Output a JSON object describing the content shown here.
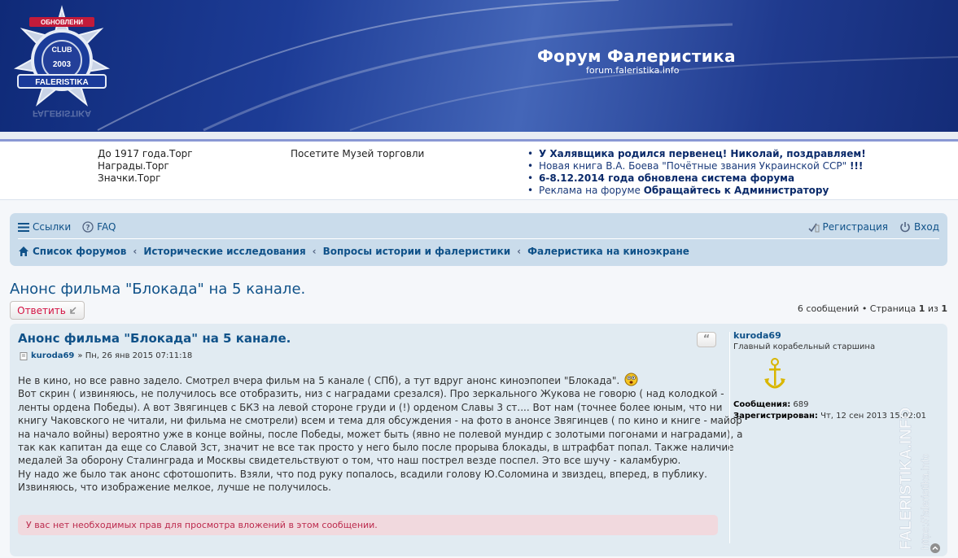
{
  "header": {
    "site_title": "Форум Фалеристика",
    "site_url": "forum.faleristika.info",
    "logo_text": "FALERISTIKA"
  },
  "top_links": {
    "col1": [
      "До 1917 года.Торг",
      "Награды.Торг",
      "Значки.Торг"
    ],
    "col2": [
      "Посетите Музей торговли"
    ],
    "news": [
      {
        "bold": "У Халявщика родился первенец! Николай, поздравляем!",
        "normal": ""
      },
      {
        "bold": "",
        "normal": "Новая книга В.А. Боева \"Почётные звания Украинской ССР\" ",
        "bold_tail": "!!!"
      },
      {
        "bold": "6-8.12.2014 года обновлена система форума",
        "normal": ""
      },
      {
        "bold": "",
        "normal": "Реклама на форуме ",
        "bold_tail": "Обращайтесь к Администратору"
      }
    ]
  },
  "navbar": {
    "links_label": "Ссылки",
    "faq_label": "FAQ",
    "register_label": "Регистрация",
    "login_label": "Вход",
    "breadcrumb": [
      "Список форумов",
      "Исторические исследования",
      "Вопросы истории и фалеристики",
      "Фалеристика на киноэкране"
    ],
    "crumb_separator": "‹"
  },
  "topic": {
    "title": "Анонс фильма \"Блокада\" на 5 канале.",
    "reply_label": "Ответить",
    "pagination": {
      "prefix": "6 сообщений • Страница ",
      "current": "1",
      "middle": " из ",
      "total": "1"
    }
  },
  "post": {
    "title": "Анонс фильма \"Блокада\" на 5 канале.",
    "quote_label": "“",
    "author": "kuroda69",
    "meta_rest": "» Пн, 26 янв 2015 07:11:18",
    "body": [
      "Не в кино, но все равно задело. Смотрел вчера фильм на 5 канале ( СПб), а тут вдруг анонс киноэпопеи \"Блокада\".",
      "Вот скрин ( извиняюсь, не получилось все отобразить, низ с наградами срезался). Про зеркального Жукова не говорю ( над колодкой -",
      "ленты ордена Победы). А вот Звягинцев с БКЗ на левой стороне груди и (!) орденом Славы 3 ст.... Вот нам (точнее более юным, что ни",
      "книгу Чаковского не читали, ни фильма не смотрели) всем и тема для обсуждения - на фото в анонсе Звягинцев ( по кино и книге - майор",
      "на начало войны) вероятно уже в конце войны, после Победы, может быть (явно не полевой мундир с золотыми погонами и наградами), а",
      "так как капитан да еще со Славой 3ст, значит не все так просто у него было после прорыва блокады, в штрафбат попал. Также наличие",
      "медалей За оборону Сталинграда и Москвы свидетельствуют о том, что наш пострел везде поспел. Это все шучу - каламбурю.",
      "Ну надо же было так анонс сфотошопить. Взяли, что под руку попалось, всадили голову Ю.Соломина и звиздец, вперед, в публику.",
      "Извиняюсь, что изображение мелкое, лучше не получилось."
    ],
    "notice": "У вас нет необходимых прав для просмотра вложений в этом сообщении."
  },
  "profile": {
    "username": "kuroda69",
    "rank": "Главный корабельный старшина",
    "posts_label": "Сообщения:",
    "posts_value": "689",
    "registered_label": "Зарегистрирован:",
    "registered_value": "Чт, 12 сен 2013 15:02:01"
  },
  "watermark": {
    "line1": "FALERISTIKA.INFO",
    "line2": "https://faleristika.info"
  },
  "colors": {
    "link": "#105289",
    "panel": "#cadceb",
    "post_bg": "#e1ebf2",
    "reply_red": "#d31141",
    "notice_bg": "#f1d9de"
  }
}
